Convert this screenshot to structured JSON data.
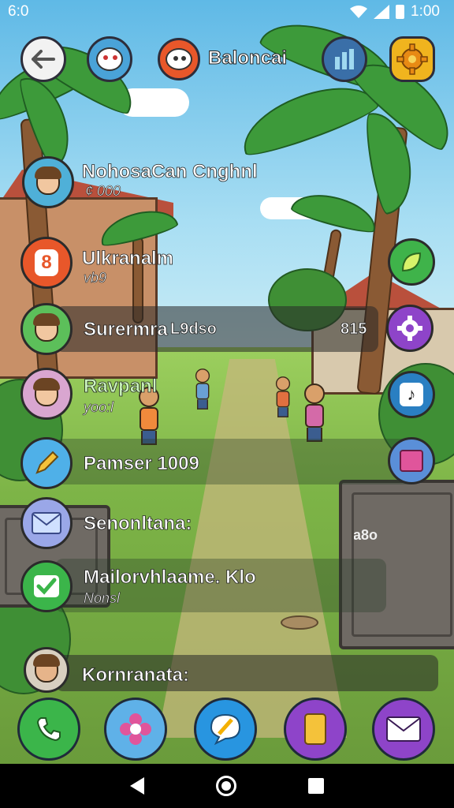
{
  "status_bar": {
    "time": "6:0",
    "clock": "1:00"
  },
  "header": {
    "title": "Baloncai",
    "back_icon": "arrow-left-icon",
    "app_icon": "cartoon-face-icon",
    "stats_icon": "bar-chart-icon",
    "settings_icon": "gear-icon"
  },
  "list": {
    "items": [
      {
        "title": "NohosaCan Cnghnl",
        "subtitle": "¢ 000",
        "avatar_icon": "boy-avatar-icon"
      },
      {
        "title": "Ulkranalm",
        "subtitle": "vb9",
        "avatar_icon": "orange-b-icon"
      },
      {
        "title": "Surermra",
        "subtitle": "",
        "extra": "L9dso",
        "right_value": "815",
        "avatar_icon": "girl-avatar-icon"
      },
      {
        "title": "Ravpanl",
        "subtitle": "yoo:l",
        "avatar_icon": "family-avatar-icon"
      },
      {
        "title": "Pamser 1009",
        "subtitle": "",
        "avatar_icon": "pencil-icon"
      },
      {
        "title": "Senonltana:",
        "subtitle": "",
        "avatar_icon": "envelope-icon"
      },
      {
        "title": "Mailorvhlaame. Klo",
        "subtitle": "Nonsl",
        "avatar_icon": "checkmark-icon"
      },
      {
        "title": "Kornranata:",
        "subtitle": "",
        "avatar_icon": "man-avatar-icon"
      }
    ]
  },
  "side_buttons": [
    {
      "icon": "leaf-icon",
      "color": "#3fb34a"
    },
    {
      "icon": "gear-icon",
      "color": "#8e44c9"
    },
    {
      "icon": "music-note-icon",
      "color": "#2a7fc2"
    },
    {
      "icon": "gift-icon",
      "color": "#5a8fd8"
    }
  ],
  "crate_label": "a8o",
  "dock": [
    {
      "icon": "phone-icon",
      "color": "#3bb54a"
    },
    {
      "icon": "flower-icon",
      "color": "#5fb1e8"
    },
    {
      "icon": "chat-bubble-icon",
      "color": "#2895e0"
    },
    {
      "icon": "battery-icon",
      "color": "#8e44c9"
    },
    {
      "icon": "envelope-icon",
      "color": "#8e44c9"
    }
  ],
  "colors": {
    "accent_orange": "#e8572a",
    "accent_purple": "#8e44c9",
    "accent_blue": "#2895e0",
    "accent_green": "#3bb54a"
  }
}
